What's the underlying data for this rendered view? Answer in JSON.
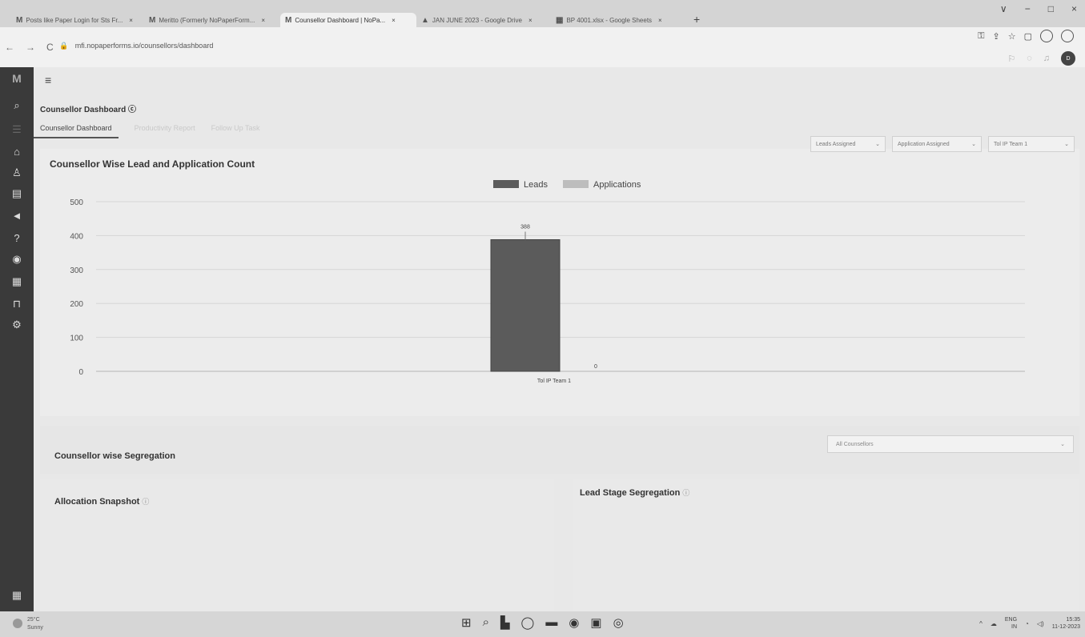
{
  "browser": {
    "tabs": [
      {
        "label": "Posts like Paper Login for Sts Fr...",
        "fav": "M"
      },
      {
        "label": "Meritto (Formerly NoPaperForm...",
        "fav": "M"
      },
      {
        "label": "Counsellor Dashboard | NoPa...",
        "fav": "M",
        "active": true
      },
      {
        "label": "JAN JUNE 2023 - Google Drive",
        "fav": "▲"
      },
      {
        "label": "BP 4001.xlsx - Google Sheets",
        "fav": "▦"
      }
    ],
    "close": "×",
    "new_tab": "+",
    "url": "mfi.nopaperforms.io/counsellors/dashboard",
    "window_controls": [
      "∨",
      "−",
      "□",
      "×"
    ]
  },
  "sidebar": {
    "logo": "M",
    "icons": [
      "search-icon",
      "list-icon",
      "bank-icon",
      "user-icon",
      "document-icon",
      "megaphone-icon",
      "help-icon",
      "currency-icon",
      "calendar-icon",
      "lock-icon",
      "settings-icon"
    ],
    "apps_icon": "▦"
  },
  "header": {
    "menu_icon": "≡",
    "page_title": "Counsellor Dashboard ⓒ",
    "avatar_initials": "D"
  },
  "tabs": [
    {
      "label": "Counsellor Dashboard",
      "active": true
    },
    {
      "label": "Productivity Report",
      "active": false
    },
    {
      "label": "Follow Up Task",
      "active": false
    }
  ],
  "filters": {
    "leads": "Leads Assigned",
    "applications": "Application Assigned",
    "team": "Tol IP Team 1"
  },
  "chart_section": {
    "title": "Counsellor Wise Lead and Application Count"
  },
  "chart_data": {
    "type": "bar",
    "categories": [
      "Tol IP Team 1"
    ],
    "series": [
      {
        "name": "Leads",
        "values": [
          388
        ],
        "color": "#5b5b5b"
      },
      {
        "name": "Applications",
        "values": [
          0
        ],
        "color": "#bdbdbd"
      }
    ],
    "data_labels": [
      "388",
      "0"
    ],
    "ylim": [
      0,
      500
    ],
    "yticks": [
      0,
      100,
      200,
      300,
      400,
      500
    ],
    "legend": "top-center",
    "grid": true
  },
  "segregation": {
    "title": "Counsellor wise Segregation",
    "select_value": "All Counsellors"
  },
  "allocation": {
    "title": "Allocation Snapshot",
    "info": "ⓘ"
  },
  "lead_stage": {
    "title": "Lead Stage Segregation",
    "info": "ⓘ"
  },
  "taskbar": {
    "weather_temp": "25°C",
    "weather_desc": "Sunny",
    "lang": "ENG",
    "region": "IN",
    "time": "15:35",
    "date": "11-12-2023"
  }
}
